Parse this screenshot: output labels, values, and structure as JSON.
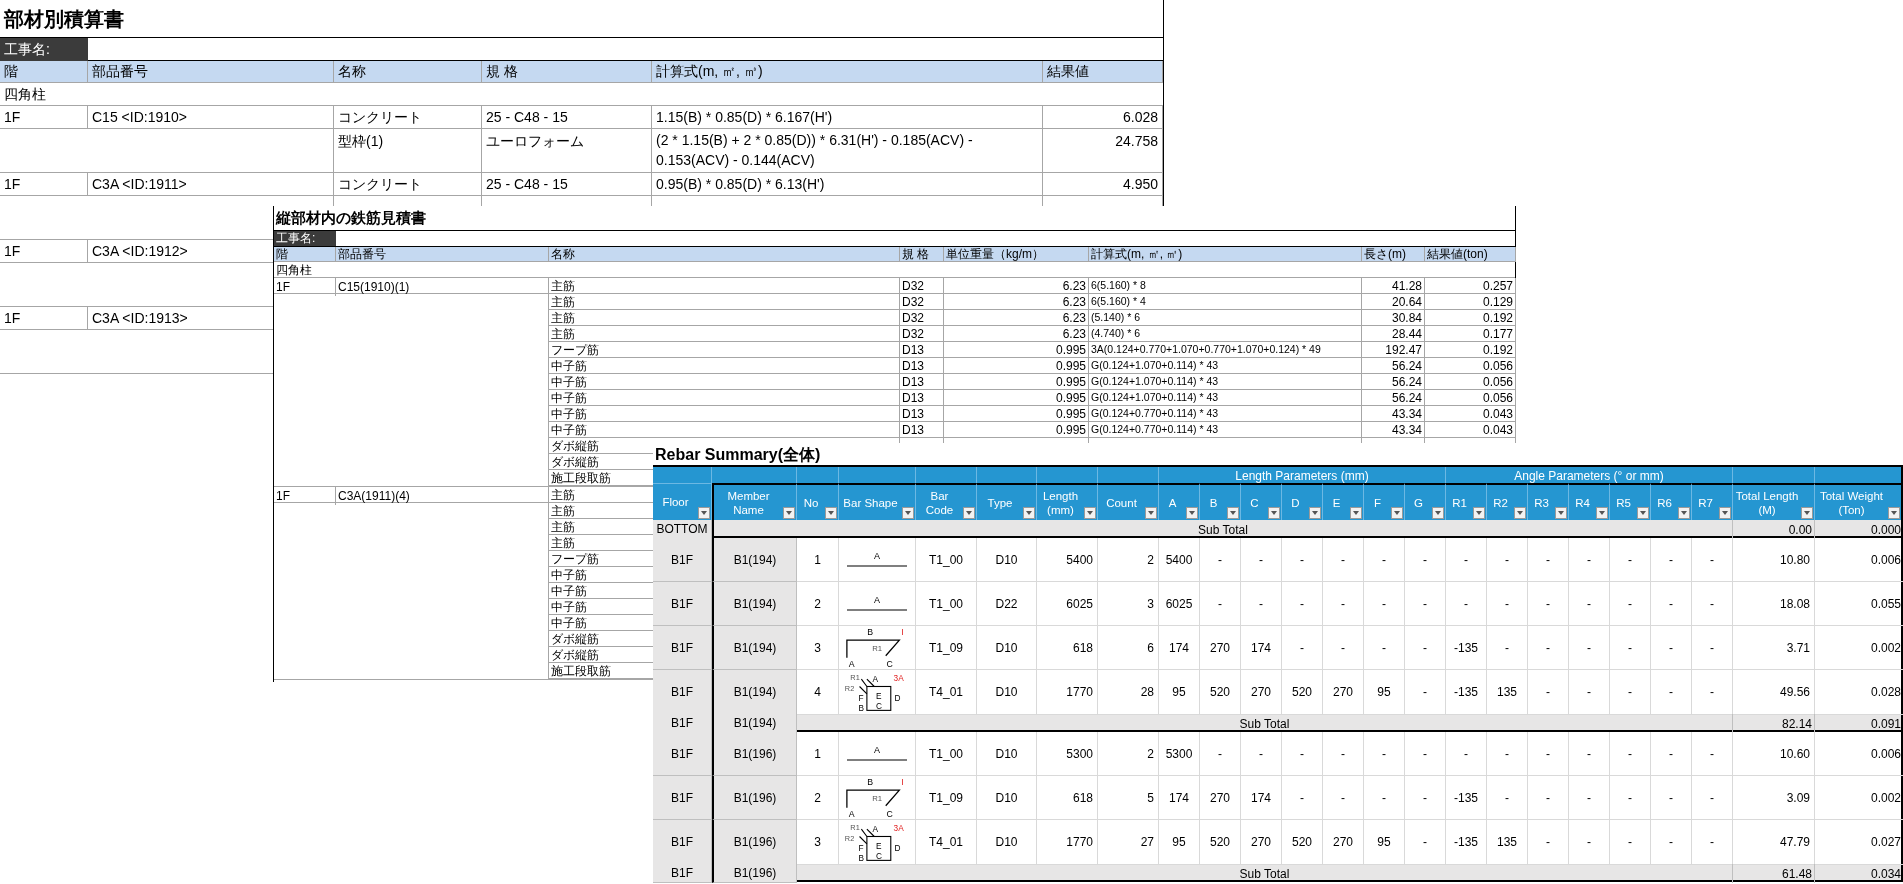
{
  "estimate_sheet": {
    "title": "部材別積算書",
    "project_label": "工事名:",
    "columns": [
      "階",
      "部品番号",
      "名称",
      "規 格",
      "計算式(m, ㎡, ㎥)",
      "結果値"
    ],
    "rows": [
      {
        "kind": "category",
        "label": "四角柱"
      },
      {
        "kind": "item",
        "floor": "1F",
        "part": "C15 <ID:1910>",
        "name": "コンクリート",
        "spec": "25 - C48 - 15",
        "formula": "1.15(B) * 0.85(D) * 6.167(H')",
        "result": "6.028"
      },
      {
        "kind": "sub",
        "name": "型枠(1)",
        "spec": "ユーロフォーム",
        "formula": "(2 * 1.15(B) + 2 * 0.85(D)) * 6.31(H') - 0.185(ACV) - 0.153(ACV) - 0.144(ACV)",
        "result": "24.758"
      },
      {
        "kind": "item",
        "floor": "1F",
        "part": "C3A <ID:1911>",
        "name": "コンクリート",
        "spec": "25 - C48 - 15",
        "formula": "0.95(B) * 0.85(D) * 6.13(H')",
        "result": "4.950"
      },
      {
        "kind": "sub"
      },
      {
        "kind": "item",
        "floor": "1F",
        "part": "C3A <ID:1912>"
      },
      {
        "kind": "sub"
      },
      {
        "kind": "item",
        "floor": "1F",
        "part": "C3A <ID:1913>"
      },
      {
        "kind": "sub"
      }
    ]
  },
  "rebar_estimate_sheet": {
    "title": "縦部材内の鉄筋見積書",
    "project_label": "工事名:",
    "columns": [
      "階",
      "部品番号",
      "名称",
      "規 格",
      "単位重量（kg/m）",
      "計算式(m, ㎡, ㎥)",
      "長さ(m)",
      "結果値(ton)"
    ],
    "category": "四角柱",
    "groups": [
      {
        "floor": "1F",
        "part": "C15(1910)(1)",
        "rows": [
          {
            "name": "主筋",
            "spec": "D32",
            "unit_weight": "6.23",
            "formula": "6(5.160) * 8",
            "length": "41.28",
            "result": "0.257"
          },
          {
            "name": "主筋",
            "spec": "D32",
            "unit_weight": "6.23",
            "formula": "6(5.160) * 4",
            "length": "20.64",
            "result": "0.129"
          },
          {
            "name": "主筋",
            "spec": "D32",
            "unit_weight": "6.23",
            "formula": "(5.140) * 6",
            "length": "30.84",
            "result": "0.192"
          },
          {
            "name": "主筋",
            "spec": "D32",
            "unit_weight": "6.23",
            "formula": "(4.740) * 6",
            "length": "28.44",
            "result": "0.177"
          },
          {
            "name": "フープ筋",
            "spec": "D13",
            "unit_weight": "0.995",
            "formula": "3A(0.124+0.770+1.070+0.770+1.070+0.124) * 49",
            "length": "192.47",
            "result": "0.192"
          },
          {
            "name": "中子筋",
            "spec": "D13",
            "unit_weight": "0.995",
            "formula": "G(0.124+1.070+0.114) * 43",
            "length": "56.24",
            "result": "0.056"
          },
          {
            "name": "中子筋",
            "spec": "D13",
            "unit_weight": "0.995",
            "formula": "G(0.124+1.070+0.114) * 43",
            "length": "56.24",
            "result": "0.056"
          },
          {
            "name": "中子筋",
            "spec": "D13",
            "unit_weight": "0.995",
            "formula": "G(0.124+1.070+0.114) * 43",
            "length": "56.24",
            "result": "0.056"
          },
          {
            "name": "中子筋",
            "spec": "D13",
            "unit_weight": "0.995",
            "formula": "G(0.124+0.770+0.114) * 43",
            "length": "43.34",
            "result": "0.043"
          },
          {
            "name": "中子筋",
            "spec": "D13",
            "unit_weight": "0.995",
            "formula": "G(0.124+0.770+0.114) * 43",
            "length": "43.34",
            "result": "0.043"
          },
          {
            "name": "ダボ縦筋"
          },
          {
            "name": "ダボ縦筋"
          },
          {
            "name": "施工段取筋"
          }
        ]
      },
      {
        "floor": "1F",
        "part": "C3A(1911)(4)",
        "rows": [
          {
            "name": "主筋"
          },
          {
            "name": "主筋"
          },
          {
            "name": "主筋"
          },
          {
            "name": "主筋"
          },
          {
            "name": "フープ筋"
          },
          {
            "name": "中子筋"
          },
          {
            "name": "中子筋"
          },
          {
            "name": "中子筋"
          },
          {
            "name": "中子筋"
          },
          {
            "name": "ダボ縦筋"
          },
          {
            "name": "ダボ縦筋"
          },
          {
            "name": "施工段取筋"
          }
        ]
      }
    ]
  },
  "rebar_summary": {
    "title": "Rebar Summary(全体)",
    "group_headers": [
      "Length Parameters (mm)",
      "Angle Parameters (° or mm)"
    ],
    "columns": [
      "Floor",
      "Member Name",
      "No",
      "Bar Shape",
      "Bar Code",
      "Type",
      "Length (mm)",
      "Count",
      "A",
      "B",
      "C",
      "D",
      "E",
      "F",
      "G",
      "R1",
      "R2",
      "R3",
      "R4",
      "R5",
      "R6",
      "R7",
      "Total Length (M)",
      "Total Weight (Ton)"
    ],
    "rows": [
      {
        "kind": "subtotal",
        "floor": "BOTTOM",
        "label": "Sub Total",
        "total_length": "0.00",
        "total_weight": "0.000"
      },
      {
        "kind": "bar",
        "floor": "B1F",
        "member": "B1(194)",
        "no": "1",
        "shape": {
          "kind": "straight",
          "labels": [
            "A"
          ]
        },
        "code": "T1_00",
        "type": "D10",
        "length": "5400",
        "count": "2",
        "params": [
          "5400",
          "-",
          "-",
          "-",
          "-",
          "-",
          "-",
          "-",
          "-",
          "-",
          "-",
          "-",
          "-",
          "-"
        ],
        "total_length": "10.80",
        "total_weight": "0.006"
      },
      {
        "kind": "bar",
        "floor": "B1F",
        "member": "B1(194)",
        "no": "2",
        "shape": {
          "kind": "straight",
          "labels": [
            "A"
          ]
        },
        "code": "T1_00",
        "type": "D22",
        "length": "6025",
        "count": "3",
        "params": [
          "6025",
          "-",
          "-",
          "-",
          "-",
          "-",
          "-",
          "-",
          "-",
          "-",
          "-",
          "-",
          "-",
          "-"
        ],
        "total_length": "18.08",
        "total_weight": "0.055"
      },
      {
        "kind": "bar",
        "floor": "B1F",
        "member": "B1(194)",
        "no": "3",
        "shape": {
          "kind": "hook",
          "labels": [
            "B",
            "R1",
            "A",
            "C"
          ],
          "mark": "I"
        },
        "code": "T1_09",
        "type": "D10",
        "length": "618",
        "count": "6",
        "params": [
          "174",
          "270",
          "174",
          "-",
          "-",
          "-",
          "-",
          "-135",
          "-",
          "-",
          "-",
          "-",
          "-",
          "-"
        ],
        "total_length": "3.71",
        "total_weight": "0.002"
      },
      {
        "kind": "bar",
        "floor": "B1F",
        "member": "B1(194)",
        "no": "4",
        "shape": {
          "kind": "stirrup",
          "labels": [
            "R1",
            "A",
            "R2",
            "F",
            "E",
            "D",
            "B",
            "C"
          ],
          "mark": "3A"
        },
        "code": "T4_01",
        "type": "D10",
        "length": "1770",
        "count": "28",
        "params": [
          "95",
          "520",
          "270",
          "520",
          "270",
          "95",
          "-",
          "-135",
          "135",
          "-",
          "-",
          "-",
          "-",
          "-"
        ],
        "total_length": "49.56",
        "total_weight": "0.028"
      },
      {
        "kind": "subtotal",
        "floor": "B1F",
        "member": "B1(194)",
        "label": "Sub Total",
        "total_length": "82.14",
        "total_weight": "0.091"
      },
      {
        "kind": "bar",
        "floor": "B1F",
        "member": "B1(196)",
        "no": "1",
        "shape": {
          "kind": "straight",
          "labels": [
            "A"
          ]
        },
        "code": "T1_00",
        "type": "D10",
        "length": "5300",
        "count": "2",
        "params": [
          "5300",
          "-",
          "-",
          "-",
          "-",
          "-",
          "-",
          "-",
          "-",
          "-",
          "-",
          "-",
          "-",
          "-"
        ],
        "total_length": "10.60",
        "total_weight": "0.006"
      },
      {
        "kind": "bar",
        "floor": "B1F",
        "member": "B1(196)",
        "no": "2",
        "shape": {
          "kind": "hook",
          "labels": [
            "B",
            "R1",
            "A",
            "C"
          ],
          "mark": "I"
        },
        "code": "T1_09",
        "type": "D10",
        "length": "618",
        "count": "5",
        "params": [
          "174",
          "270",
          "174",
          "-",
          "-",
          "-",
          "-",
          "-135",
          "-",
          "-",
          "-",
          "-",
          "-",
          "-"
        ],
        "total_length": "3.09",
        "total_weight": "0.002"
      },
      {
        "kind": "bar",
        "floor": "B1F",
        "member": "B1(196)",
        "no": "3",
        "shape": {
          "kind": "stirrup",
          "labels": [
            "R1",
            "A",
            "R2",
            "F",
            "E",
            "D",
            "B",
            "C"
          ],
          "mark": "3A"
        },
        "code": "T4_01",
        "type": "D10",
        "length": "1770",
        "count": "27",
        "params": [
          "95",
          "520",
          "270",
          "520",
          "270",
          "95",
          "-",
          "-135",
          "135",
          "-",
          "-",
          "-",
          "-",
          "-"
        ],
        "total_length": "47.79",
        "total_weight": "0.027"
      },
      {
        "kind": "subtotal",
        "floor": "B1F",
        "member": "B1(196)",
        "label": "Sub Total",
        "total_length": "61.48",
        "total_weight": "0.034"
      }
    ]
  }
}
